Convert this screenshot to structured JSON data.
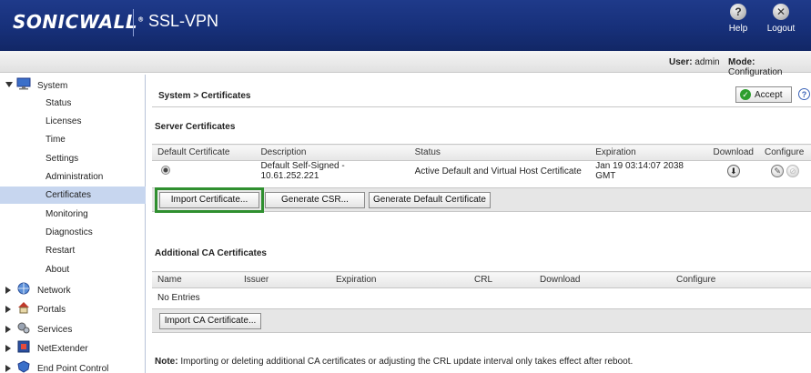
{
  "header": {
    "brand": "SONICWALL",
    "product": "SSL-VPN",
    "help_label": "Help",
    "logout_label": "Logout"
  },
  "userbar": {
    "user_label": "User:",
    "user_value": "admin",
    "mode_label": "Mode:",
    "mode_value": "Configuration"
  },
  "sidebar": {
    "groups": [
      {
        "label": "System",
        "icon": "monitor-icon",
        "expanded": true
      },
      {
        "label": "Network",
        "icon": "globe-icon",
        "expanded": false
      },
      {
        "label": "Portals",
        "icon": "house-icon",
        "expanded": false
      },
      {
        "label": "Services",
        "icon": "gears-icon",
        "expanded": false
      },
      {
        "label": "NetExtender",
        "icon": "netextender-icon",
        "expanded": false
      },
      {
        "label": "End Point Control",
        "icon": "endpoint-icon",
        "expanded": false
      }
    ],
    "system_items": [
      "Status",
      "Licenses",
      "Time",
      "Settings",
      "Administration",
      "Certificates",
      "Monitoring",
      "Diagnostics",
      "Restart",
      "About"
    ],
    "active_item": "Certificates"
  },
  "page": {
    "title": "System > Certificates",
    "accept_label": "Accept",
    "help_glyph": "?"
  },
  "server_certs": {
    "title": "Server Certificates",
    "columns": [
      "Default Certificate",
      "Description",
      "Status",
      "Expiration",
      "Download",
      "Configure"
    ],
    "rows": [
      {
        "description": "Default Self-Signed - 10.61.252.221",
        "status": "Active Default and Virtual Host Certificate",
        "expiration": "Jan 19 03:14:07 2038 GMT"
      }
    ],
    "buttons": {
      "import": "Import Certificate...",
      "csr": "Generate CSR...",
      "default": "Generate Default Certificate"
    }
  },
  "ca_certs": {
    "title": "Additional CA Certificates",
    "columns": [
      "Name",
      "Issuer",
      "Expiration",
      "CRL",
      "Download",
      "Configure"
    ],
    "empty_text": "No Entries",
    "import_button": "Import CA Certificate..."
  },
  "note": {
    "label": "Note:",
    "text": " Importing or deleting additional CA certificates or adjusting the CRL update interval only takes effect after reboot."
  },
  "colors": {
    "header_blue": "#17307a",
    "active_nav": "#c7d6ef",
    "highlight_green": "#2f8f2f",
    "accept_green": "#2e9e2e"
  }
}
